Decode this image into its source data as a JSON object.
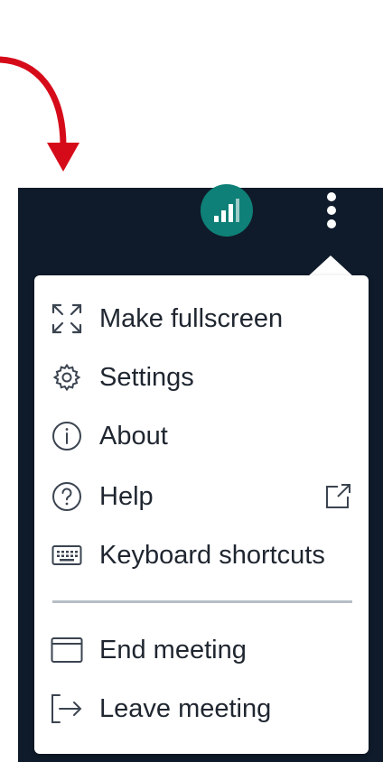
{
  "colors": {
    "panel_bg": "#0f1b2a",
    "connection_button": "#0e8077",
    "arrow": "#d60b1a",
    "menu_text": "#1f2630",
    "divider": "#b6bec6"
  },
  "toolbar": {
    "connection_icon": "signal-bars-icon",
    "more_icon": "more-vertical-icon"
  },
  "menu": {
    "items": [
      {
        "label": "Make fullscreen",
        "icon": "fullscreen-icon"
      },
      {
        "label": "Settings",
        "icon": "gear-icon"
      },
      {
        "label": "About",
        "icon": "info-icon"
      },
      {
        "label": "Help",
        "icon": "help-icon",
        "trailing_icon": "external-link-icon"
      },
      {
        "label": "Keyboard shortcuts",
        "icon": "keyboard-icon"
      }
    ],
    "secondary_items": [
      {
        "label": "End meeting",
        "icon": "window-icon"
      },
      {
        "label": "Leave meeting",
        "icon": "leave-icon"
      }
    ]
  }
}
